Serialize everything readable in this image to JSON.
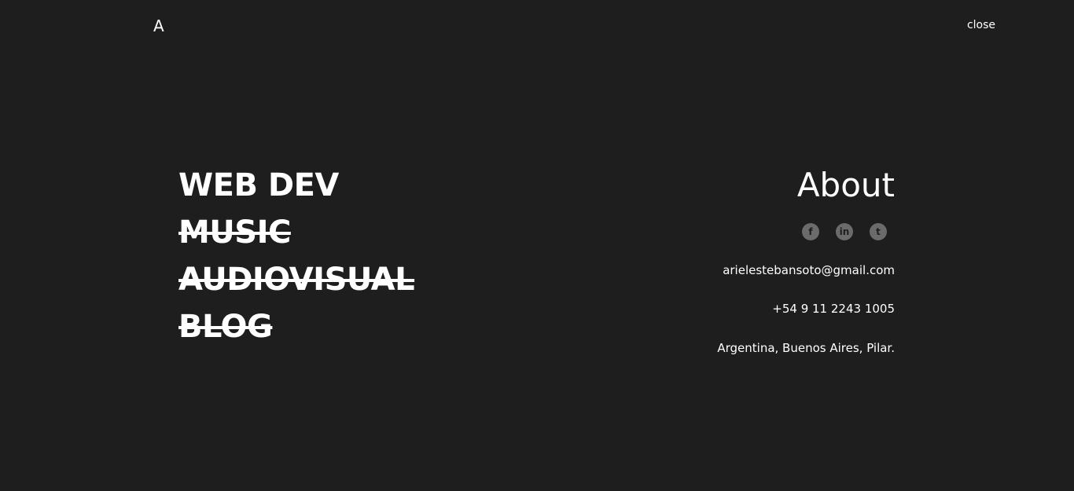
{
  "header": {
    "logo": "A",
    "close_label": "close"
  },
  "menu": {
    "items": [
      {
        "label": "WEB DEV",
        "struck": false
      },
      {
        "label": "MUSIC",
        "struck": true
      },
      {
        "label": "AUDIOVISUAL",
        "struck": true
      },
      {
        "label": "BLOG",
        "struck": true
      }
    ]
  },
  "about": {
    "title": "About",
    "socials": [
      {
        "icon": "facebook-icon",
        "glyph": "f"
      },
      {
        "icon": "linkedin-icon",
        "glyph": "in"
      },
      {
        "icon": "tumblr-icon",
        "glyph": "t"
      }
    ],
    "email": "arielestebansoto@gmail.com",
    "phone": "+54 9 11 2243 1005",
    "location": "Argentina, Buenos Aires, Pilar."
  },
  "colors": {
    "background": "#1e1e1e",
    "text": "#ffffff",
    "social_icon_bg": "#6b6b6b"
  }
}
